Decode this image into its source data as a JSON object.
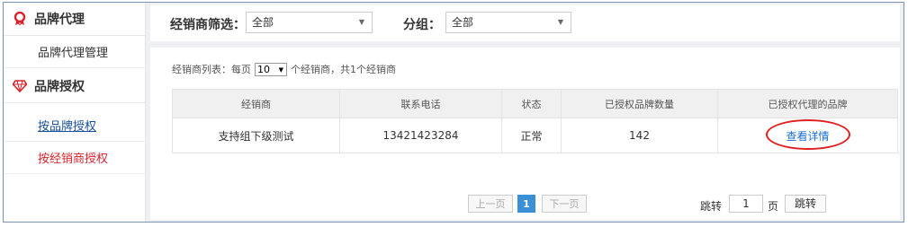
{
  "sidebar": {
    "section1": {
      "title": "品牌代理",
      "icon": "ribbon-icon",
      "items": [
        {
          "label": "品牌代理管理"
        }
      ]
    },
    "section2": {
      "title": "品牌授权",
      "icon": "diamond-icon",
      "items": [
        {
          "label": "按品牌授权",
          "state": "link-underlined"
        },
        {
          "label": "按经销商授权",
          "state": "active"
        }
      ]
    }
  },
  "filters": {
    "dealer_label": "经销商筛选：",
    "dealer_value": "全部",
    "group_label": "分组：",
    "group_value": "全部"
  },
  "list": {
    "info_prefix": "经销商列表：",
    "per_page_prefix": "每页",
    "per_page_value": "10",
    "per_page_suffix": "个经销商，共1个经销商"
  },
  "table": {
    "columns": [
      "经销商",
      "联系电话",
      "状态",
      "已授权品牌数量",
      "已授权代理的品牌"
    ],
    "rows": [
      {
        "dealer": "支持组下级测试",
        "phone": "13421423284",
        "status": "正常",
        "brand_count": "142",
        "action": "查看详情"
      }
    ]
  },
  "pagination": {
    "prev": "上一页",
    "current": "1",
    "next": "下一页",
    "jump_label": "跳转",
    "jump_value": "1",
    "page_unit": "页",
    "jump_button": "跳转"
  },
  "colors": {
    "accent_red": "#e02020",
    "link_blue": "#1a6fd0",
    "active_page": "#3b8fd6"
  }
}
